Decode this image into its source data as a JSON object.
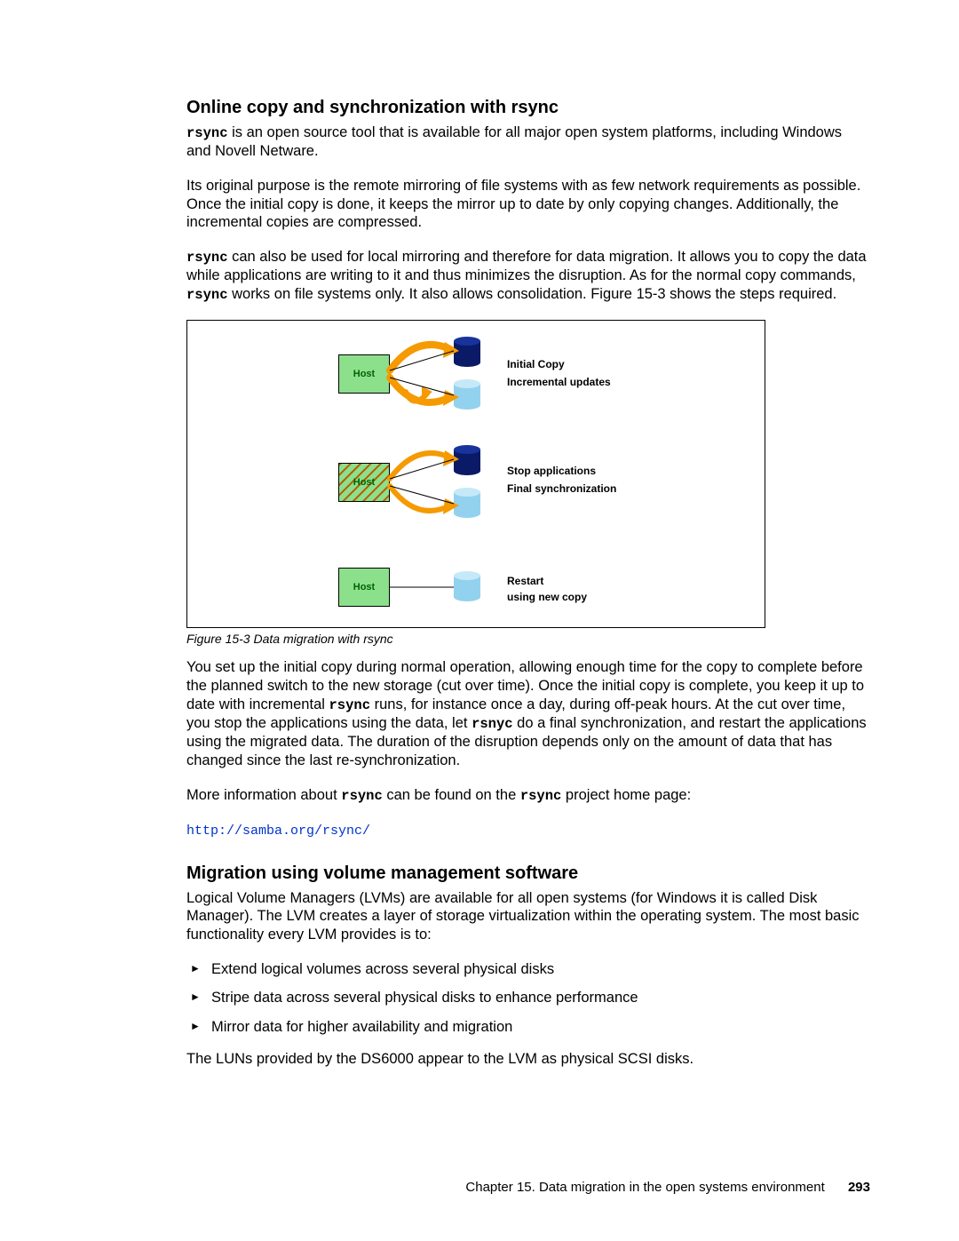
{
  "section1": {
    "heading": "Online copy and synchronization with rsync",
    "p1_pre": "rsync",
    "p1_post": " is an open source tool that is available for all major open system platforms, including Windows and Novell Netware.",
    "p2": "Its original purpose is the remote mirroring of file systems with as few network requirements as possible. Once the initial copy is done, it keeps the mirror up to date by only copying changes. Additionally, the incremental copies are compressed.",
    "p3_pre": "rsync",
    "p3_mid1": " can also be used for local mirroring and therefore for data migration. It allows you to copy the data while applications are writing to it and thus minimizes the disruption. As for the normal copy commands, ",
    "p3_mono2": "rsync",
    "p3_mid2": " works on file systems only. It also allows consolidation. Figure 15-3 shows the steps required."
  },
  "figure": {
    "caption": "Figure 15-3   Data migration with rsync",
    "host": "Host",
    "row1a": "Initial Copy",
    "row1b": "Incremental updates",
    "row2a": "Stop applications",
    "row2b": "Final synchronization",
    "row3a": "Restart",
    "row3b": "using new copy"
  },
  "after_figure": {
    "p1_a": "You set up the initial copy during normal operation, allowing enough time for the copy to complete before the planned switch to the new storage (cut over time). Once the initial copy is complete, you keep it up to date with incremental ",
    "p1_mono1": "rsync",
    "p1_b": " runs, for instance once a day, during off-peak hours. At the cut over time, you stop the applications using the data, let ",
    "p1_mono2": "rsnyc",
    "p1_c": " do a final synchronization, and restart the applications using the migrated data. The duration of the disruption depends only on the amount of data that has changed since the last re-synchronization.",
    "p2_a": "More information about ",
    "p2_mono1": "rsync",
    "p2_b": " can be found on the ",
    "p2_mono2": "rsync",
    "p2_c": " project home page:",
    "link": "http://samba.org/rsync/"
  },
  "section2": {
    "heading": "Migration using volume management software",
    "p1": "Logical Volume Managers (LVMs) are available for all open systems (for Windows it is called Disk Manager). The LVM creates a layer of storage virtualization within the operating system. The most basic functionality every LVM provides is to:",
    "b1": "Extend logical volumes across several physical disks",
    "b2": "Stripe data across several physical disks to enhance performance",
    "b3": "Mirror data for higher availability and migration",
    "p2": "The LUNs provided by the DS6000 appear to the LVM as physical SCSI disks."
  },
  "footer": {
    "chapter": "Chapter 15. Data migration in the open systems environment",
    "page": "293"
  }
}
